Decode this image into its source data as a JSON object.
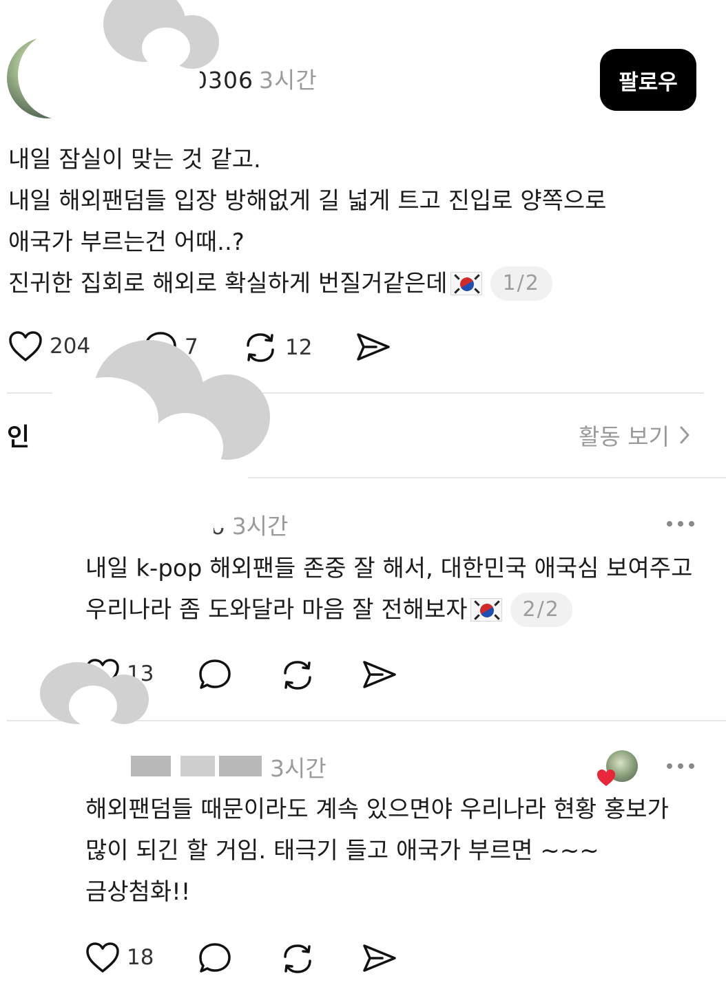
{
  "header": {
    "username_visible": "0306",
    "time": "3시간",
    "follow_label": "팔로우"
  },
  "post": {
    "lines": [
      "내일 잠실이 맞는 것 같고.",
      "내일 해외팬덤들 입장 방해없게 길 넓게 트고 진입로 양쪽으로",
      "애국가 부르는건 어때..?",
      "진귀한 집회로 해외로 확실하게 번질거같은데"
    ],
    "pager": "1/2",
    "likes": "204",
    "comments": "7",
    "reposts": "12"
  },
  "activity": {
    "left_label": "인",
    "right_label": "활동 보기"
  },
  "reply1": {
    "time": "3시간",
    "lines": [
      "내일 k-pop 해외팬들 존중 잘 해서, 대한민국 애국심 보여주고",
      "우리나라 좀 도와달라 마음 잘 전해보자"
    ],
    "pager": "2/2",
    "likes": "13"
  },
  "reply2": {
    "time": "3시간",
    "lines": [
      "해외팬덤들 때문이라도 계속 있으면야 우리나라 현황 홍보가",
      "많이 되긴 할 거임. 태극기 들고 애국가 부르면 ~~~",
      "금상첨화!!"
    ],
    "likes": "18"
  },
  "colors": {
    "follow_bg": "#000000",
    "muted_text": "#9a9a9a",
    "heart_badge": "#e8283a"
  }
}
